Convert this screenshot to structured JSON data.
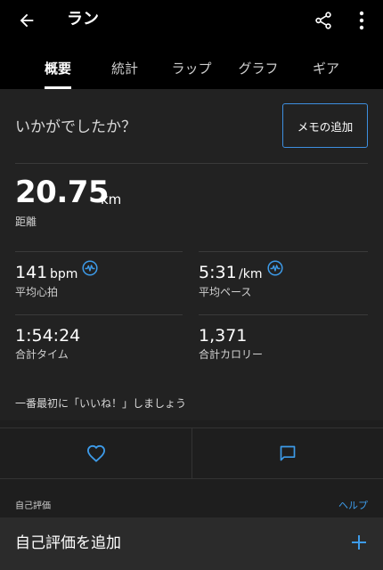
{
  "header": {
    "title": "ラン",
    "back_icon": "arrow-back-icon",
    "share_icon": "share-icon",
    "more_icon": "more-vert-icon"
  },
  "tabs": [
    {
      "label": "概要",
      "active": true
    },
    {
      "label": "統計",
      "active": false
    },
    {
      "label": "ラップ",
      "active": false
    },
    {
      "label": "グラフ",
      "active": false
    },
    {
      "label": "ギア",
      "active": false
    }
  ],
  "prompt": {
    "question": "いかがでしたか？",
    "memo_button": "メモの追加"
  },
  "distance": {
    "value": "20.75",
    "unit": "km",
    "label": "距離"
  },
  "stats": {
    "heart_rate": {
      "value": "141",
      "unit": "bpm",
      "label": "平均心拍",
      "icon": "heart-rate-icon"
    },
    "pace": {
      "value": "5:31",
      "unit": "/km",
      "label": "平均ペース",
      "icon": "heart-rate-icon"
    },
    "time": {
      "value": "1:54:24",
      "label": "合計タイム"
    },
    "calories": {
      "value": "1,371",
      "label": "合計カロリー"
    }
  },
  "social": {
    "like_prompt": "一番最初に「いいね！」しましょう",
    "like_icon": "heart-outline-icon",
    "comment_icon": "comment-icon"
  },
  "self_evaluation": {
    "section_label": "自己評価",
    "help_link": "ヘルプ",
    "add_label": "自己評価を追加",
    "add_icon": "plus-icon"
  },
  "colors": {
    "accent": "#3d9be9",
    "background": "#1e1e1e",
    "appbar": "#000000"
  }
}
